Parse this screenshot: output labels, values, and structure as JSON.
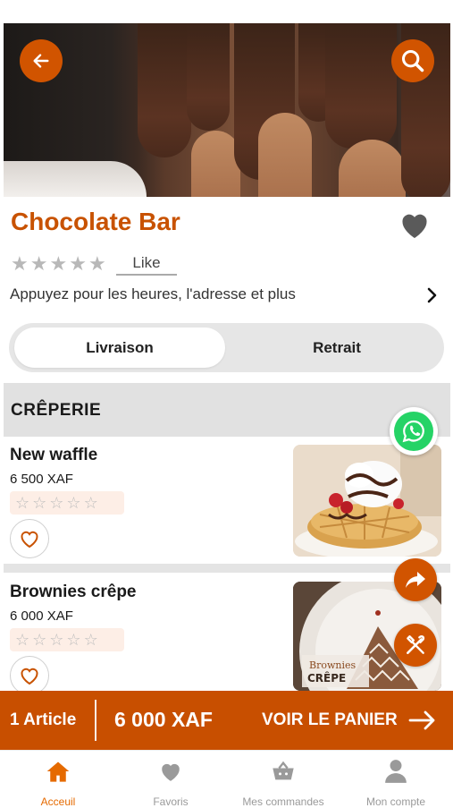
{
  "header": {
    "restaurant_name": "Chocolate Bar",
    "rating": 0,
    "max_rating": 5,
    "like_label": "Like",
    "info_text": "Appuyez pour les heures, l'adresse et plus"
  },
  "mode_toggle": {
    "options": [
      "Livraison",
      "Retrait"
    ],
    "selected": "Livraison"
  },
  "menu": {
    "section_title": "CRÊPERIE",
    "items": [
      {
        "name": "New waffle",
        "price": "6 500 XAF",
        "rating": 0
      },
      {
        "name": "Brownies crêpe",
        "price": "6 000 XAF",
        "rating": 0
      }
    ],
    "crepe_image_text": {
      "line1": "Brownies",
      "line2": "CRÊPE"
    }
  },
  "cart": {
    "count_label": "1 Article",
    "total": "6 000 XAF",
    "cta": "VOIR LE PANIER"
  },
  "tabbar": {
    "tabs": [
      {
        "label": "Acceuil",
        "icon": "home-icon",
        "active": true
      },
      {
        "label": "Favoris",
        "icon": "heart-icon",
        "active": false
      },
      {
        "label": "Mes commandes",
        "icon": "basket-icon",
        "active": false
      },
      {
        "label": "Mon compte",
        "icon": "user-icon",
        "active": false
      }
    ]
  },
  "colors": {
    "accent": "#d15400",
    "cart_bar": "#c84f00",
    "title": "#c85200",
    "active_tab": "#e56a00",
    "whatsapp": "#25d366"
  },
  "icons": [
    "back-arrow-icon",
    "search-icon",
    "heart-icon",
    "star-icon",
    "chevron-right-icon",
    "whatsapp-icon",
    "share-icon",
    "fork-knife-icon",
    "arrow-right-icon"
  ]
}
